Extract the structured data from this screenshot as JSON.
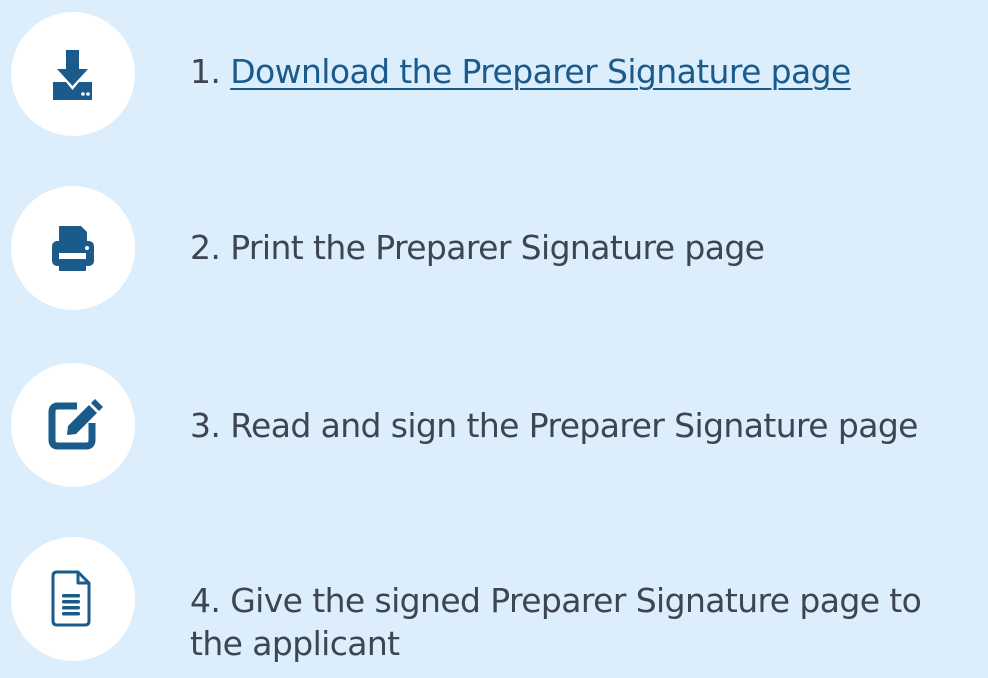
{
  "steps": [
    {
      "number": "1.",
      "label": "Download the Preparer Signature page",
      "icon": "download-icon",
      "is_link": true
    },
    {
      "number": "2.",
      "label": "Print the Preparer Signature page",
      "icon": "printer-icon",
      "is_link": false
    },
    {
      "number": "3.",
      "label": "Read and sign the Preparer Signature page",
      "icon": "edit-icon",
      "is_link": false
    },
    {
      "number": "4.",
      "label_line1": "Give the signed Preparer Signature page to",
      "label_line2": "the applicant",
      "icon": "document-icon",
      "is_link": false
    }
  ],
  "colors": {
    "background": "#dcedfc",
    "circle": "#ffffff",
    "icon": "#1a5b8c",
    "text": "#3d4551",
    "link": "#1a5b8c"
  }
}
